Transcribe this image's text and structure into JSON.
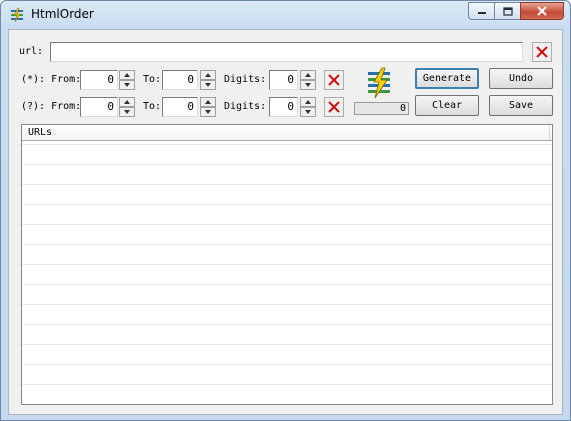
{
  "window": {
    "title": "HtmlOrder",
    "app_icon": "htmlorder-app-icon",
    "caption_buttons": [
      "minimize-icon",
      "maximize-icon",
      "close-icon"
    ]
  },
  "url_row": {
    "label": "url:",
    "value": ""
  },
  "star_row": {
    "label": "(*): From:",
    "from_value": "0",
    "to_label": "To:",
    "to_value": "0",
    "digits_label": "Digits:",
    "digits_value": "0"
  },
  "question_row": {
    "label": "(?): From:",
    "from_value": "0",
    "to_label": "To:",
    "to_value": "0",
    "digits_label": "Digits:",
    "digits_value": "0"
  },
  "progress": {
    "value": "0"
  },
  "buttons": {
    "generate": "Generate",
    "undo": "Undo",
    "clear": "Clear",
    "save": "Save"
  },
  "list": {
    "column_header": "URLs",
    "rows": []
  },
  "colors": {
    "clear_x": "#cc1111",
    "default_button_border": "#3c7fb1"
  }
}
